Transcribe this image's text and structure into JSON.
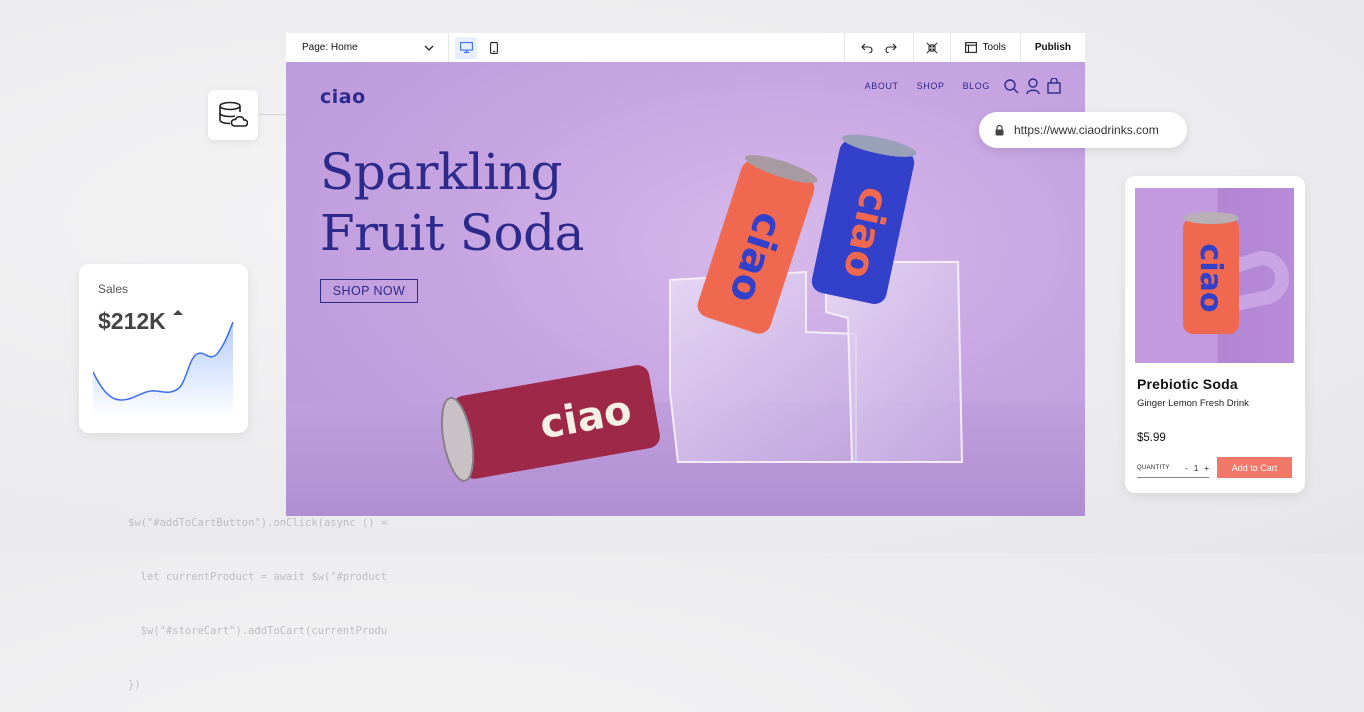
{
  "code_snippet": {
    "lines": [
      "$w(\"#addToCartButton\").onClick(async () => {",
      "  let currentProduct = await $w(\"#productPage\").getProduct()",
      "  $w(\"#storeCart\").addToCart(currentProduct._id)",
      "})"
    ]
  },
  "editor": {
    "toolbar": {
      "page_selector": "Page: Home",
      "tools_label": "Tools",
      "publish_label": "Publish"
    }
  },
  "site": {
    "logo": "ciao",
    "nav": [
      "ABOUT",
      "SHOP",
      "BLOG"
    ],
    "hero_line1": "Sparkling",
    "hero_line2": "Fruit Soda",
    "cta": "SHOP NOW",
    "can_brand": "ciao"
  },
  "url_bar": {
    "url": "https://www.ciaodrinks.com"
  },
  "sales_widget": {
    "title": "Sales",
    "value": "$212K",
    "trend": "up"
  },
  "product_card": {
    "name": "Prebiotic Soda",
    "subtitle": "Ginger Lemon Fresh Drink",
    "price": "$5.99",
    "quantity_label": "QUANTITY",
    "quantity_minus": "-",
    "quantity_value": "1",
    "quantity_plus": "+",
    "add_to_cart": "Add to Cart"
  },
  "colors": {
    "brand_navy": "#2d2a8c",
    "canvas_purple": "#c7a5e2",
    "can_red": "#f0684f",
    "can_blue": "#3340c9",
    "can_maroon": "#9e2847",
    "add_to_cart": "#f2786a"
  }
}
